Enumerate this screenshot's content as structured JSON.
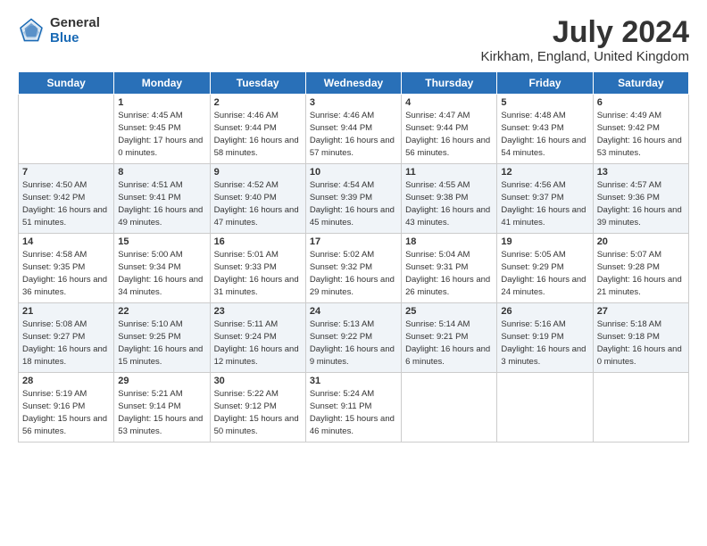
{
  "logo": {
    "general": "General",
    "blue": "Blue"
  },
  "title": "July 2024",
  "subtitle": "Kirkham, England, United Kingdom",
  "columns": [
    "Sunday",
    "Monday",
    "Tuesday",
    "Wednesday",
    "Thursday",
    "Friday",
    "Saturday"
  ],
  "weeks": [
    [
      {
        "day": "",
        "sunrise": "",
        "sunset": "",
        "daylight": ""
      },
      {
        "day": "1",
        "sunrise": "Sunrise: 4:45 AM",
        "sunset": "Sunset: 9:45 PM",
        "daylight": "Daylight: 17 hours and 0 minutes."
      },
      {
        "day": "2",
        "sunrise": "Sunrise: 4:46 AM",
        "sunset": "Sunset: 9:44 PM",
        "daylight": "Daylight: 16 hours and 58 minutes."
      },
      {
        "day": "3",
        "sunrise": "Sunrise: 4:46 AM",
        "sunset": "Sunset: 9:44 PM",
        "daylight": "Daylight: 16 hours and 57 minutes."
      },
      {
        "day": "4",
        "sunrise": "Sunrise: 4:47 AM",
        "sunset": "Sunset: 9:44 PM",
        "daylight": "Daylight: 16 hours and 56 minutes."
      },
      {
        "day": "5",
        "sunrise": "Sunrise: 4:48 AM",
        "sunset": "Sunset: 9:43 PM",
        "daylight": "Daylight: 16 hours and 54 minutes."
      },
      {
        "day": "6",
        "sunrise": "Sunrise: 4:49 AM",
        "sunset": "Sunset: 9:42 PM",
        "daylight": "Daylight: 16 hours and 53 minutes."
      }
    ],
    [
      {
        "day": "7",
        "sunrise": "Sunrise: 4:50 AM",
        "sunset": "Sunset: 9:42 PM",
        "daylight": "Daylight: 16 hours and 51 minutes."
      },
      {
        "day": "8",
        "sunrise": "Sunrise: 4:51 AM",
        "sunset": "Sunset: 9:41 PM",
        "daylight": "Daylight: 16 hours and 49 minutes."
      },
      {
        "day": "9",
        "sunrise": "Sunrise: 4:52 AM",
        "sunset": "Sunset: 9:40 PM",
        "daylight": "Daylight: 16 hours and 47 minutes."
      },
      {
        "day": "10",
        "sunrise": "Sunrise: 4:54 AM",
        "sunset": "Sunset: 9:39 PM",
        "daylight": "Daylight: 16 hours and 45 minutes."
      },
      {
        "day": "11",
        "sunrise": "Sunrise: 4:55 AM",
        "sunset": "Sunset: 9:38 PM",
        "daylight": "Daylight: 16 hours and 43 minutes."
      },
      {
        "day": "12",
        "sunrise": "Sunrise: 4:56 AM",
        "sunset": "Sunset: 9:37 PM",
        "daylight": "Daylight: 16 hours and 41 minutes."
      },
      {
        "day": "13",
        "sunrise": "Sunrise: 4:57 AM",
        "sunset": "Sunset: 9:36 PM",
        "daylight": "Daylight: 16 hours and 39 minutes."
      }
    ],
    [
      {
        "day": "14",
        "sunrise": "Sunrise: 4:58 AM",
        "sunset": "Sunset: 9:35 PM",
        "daylight": "Daylight: 16 hours and 36 minutes."
      },
      {
        "day": "15",
        "sunrise": "Sunrise: 5:00 AM",
        "sunset": "Sunset: 9:34 PM",
        "daylight": "Daylight: 16 hours and 34 minutes."
      },
      {
        "day": "16",
        "sunrise": "Sunrise: 5:01 AM",
        "sunset": "Sunset: 9:33 PM",
        "daylight": "Daylight: 16 hours and 31 minutes."
      },
      {
        "day": "17",
        "sunrise": "Sunrise: 5:02 AM",
        "sunset": "Sunset: 9:32 PM",
        "daylight": "Daylight: 16 hours and 29 minutes."
      },
      {
        "day": "18",
        "sunrise": "Sunrise: 5:04 AM",
        "sunset": "Sunset: 9:31 PM",
        "daylight": "Daylight: 16 hours and 26 minutes."
      },
      {
        "day": "19",
        "sunrise": "Sunrise: 5:05 AM",
        "sunset": "Sunset: 9:29 PM",
        "daylight": "Daylight: 16 hours and 24 minutes."
      },
      {
        "day": "20",
        "sunrise": "Sunrise: 5:07 AM",
        "sunset": "Sunset: 9:28 PM",
        "daylight": "Daylight: 16 hours and 21 minutes."
      }
    ],
    [
      {
        "day": "21",
        "sunrise": "Sunrise: 5:08 AM",
        "sunset": "Sunset: 9:27 PM",
        "daylight": "Daylight: 16 hours and 18 minutes."
      },
      {
        "day": "22",
        "sunrise": "Sunrise: 5:10 AM",
        "sunset": "Sunset: 9:25 PM",
        "daylight": "Daylight: 16 hours and 15 minutes."
      },
      {
        "day": "23",
        "sunrise": "Sunrise: 5:11 AM",
        "sunset": "Sunset: 9:24 PM",
        "daylight": "Daylight: 16 hours and 12 minutes."
      },
      {
        "day": "24",
        "sunrise": "Sunrise: 5:13 AM",
        "sunset": "Sunset: 9:22 PM",
        "daylight": "Daylight: 16 hours and 9 minutes."
      },
      {
        "day": "25",
        "sunrise": "Sunrise: 5:14 AM",
        "sunset": "Sunset: 9:21 PM",
        "daylight": "Daylight: 16 hours and 6 minutes."
      },
      {
        "day": "26",
        "sunrise": "Sunrise: 5:16 AM",
        "sunset": "Sunset: 9:19 PM",
        "daylight": "Daylight: 16 hours and 3 minutes."
      },
      {
        "day": "27",
        "sunrise": "Sunrise: 5:18 AM",
        "sunset": "Sunset: 9:18 PM",
        "daylight": "Daylight: 16 hours and 0 minutes."
      }
    ],
    [
      {
        "day": "28",
        "sunrise": "Sunrise: 5:19 AM",
        "sunset": "Sunset: 9:16 PM",
        "daylight": "Daylight: 15 hours and 56 minutes."
      },
      {
        "day": "29",
        "sunrise": "Sunrise: 5:21 AM",
        "sunset": "Sunset: 9:14 PM",
        "daylight": "Daylight: 15 hours and 53 minutes."
      },
      {
        "day": "30",
        "sunrise": "Sunrise: 5:22 AM",
        "sunset": "Sunset: 9:12 PM",
        "daylight": "Daylight: 15 hours and 50 minutes."
      },
      {
        "day": "31",
        "sunrise": "Sunrise: 5:24 AM",
        "sunset": "Sunset: 9:11 PM",
        "daylight": "Daylight: 15 hours and 46 minutes."
      },
      {
        "day": "",
        "sunrise": "",
        "sunset": "",
        "daylight": ""
      },
      {
        "day": "",
        "sunrise": "",
        "sunset": "",
        "daylight": ""
      },
      {
        "day": "",
        "sunrise": "",
        "sunset": "",
        "daylight": ""
      }
    ]
  ]
}
